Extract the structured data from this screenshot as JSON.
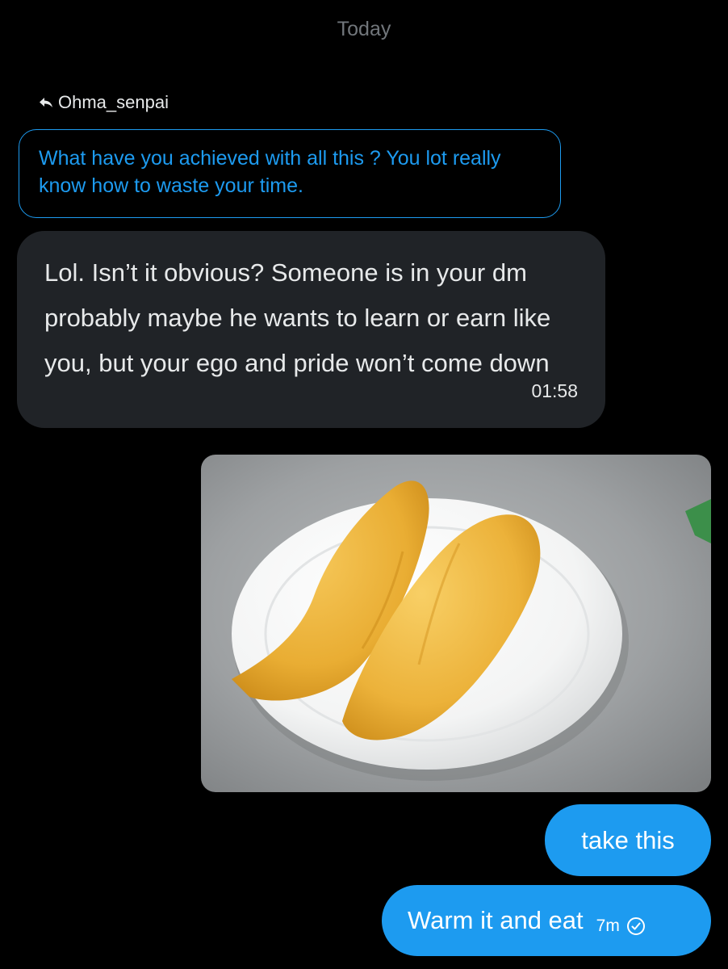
{
  "conversation": {
    "date_separator": "Today"
  },
  "reply": {
    "to_user": "Ohma_senpai",
    "quoted_text": "What have you achieved with all this ? You lot really know how to waste your time."
  },
  "messages": [
    {
      "direction": "incoming",
      "text": "Lol. Isn’t it obvious? Someone is in your dm probably maybe he wants to learn or earn like you, but your ego and pride won’t come down",
      "time": "01:58"
    },
    {
      "direction": "outgoing",
      "type": "image",
      "image_description_icon": "photo-food-plate"
    },
    {
      "direction": "outgoing",
      "text": "take this"
    },
    {
      "direction": "outgoing",
      "text": "Warm it and eat",
      "time": "7m",
      "status_icon": "check-circle-icon"
    }
  ],
  "colors": {
    "background": "#000000",
    "accent": "#1d9bf0",
    "incoming_bubble": "#202327",
    "secondary_text": "#71767b"
  }
}
